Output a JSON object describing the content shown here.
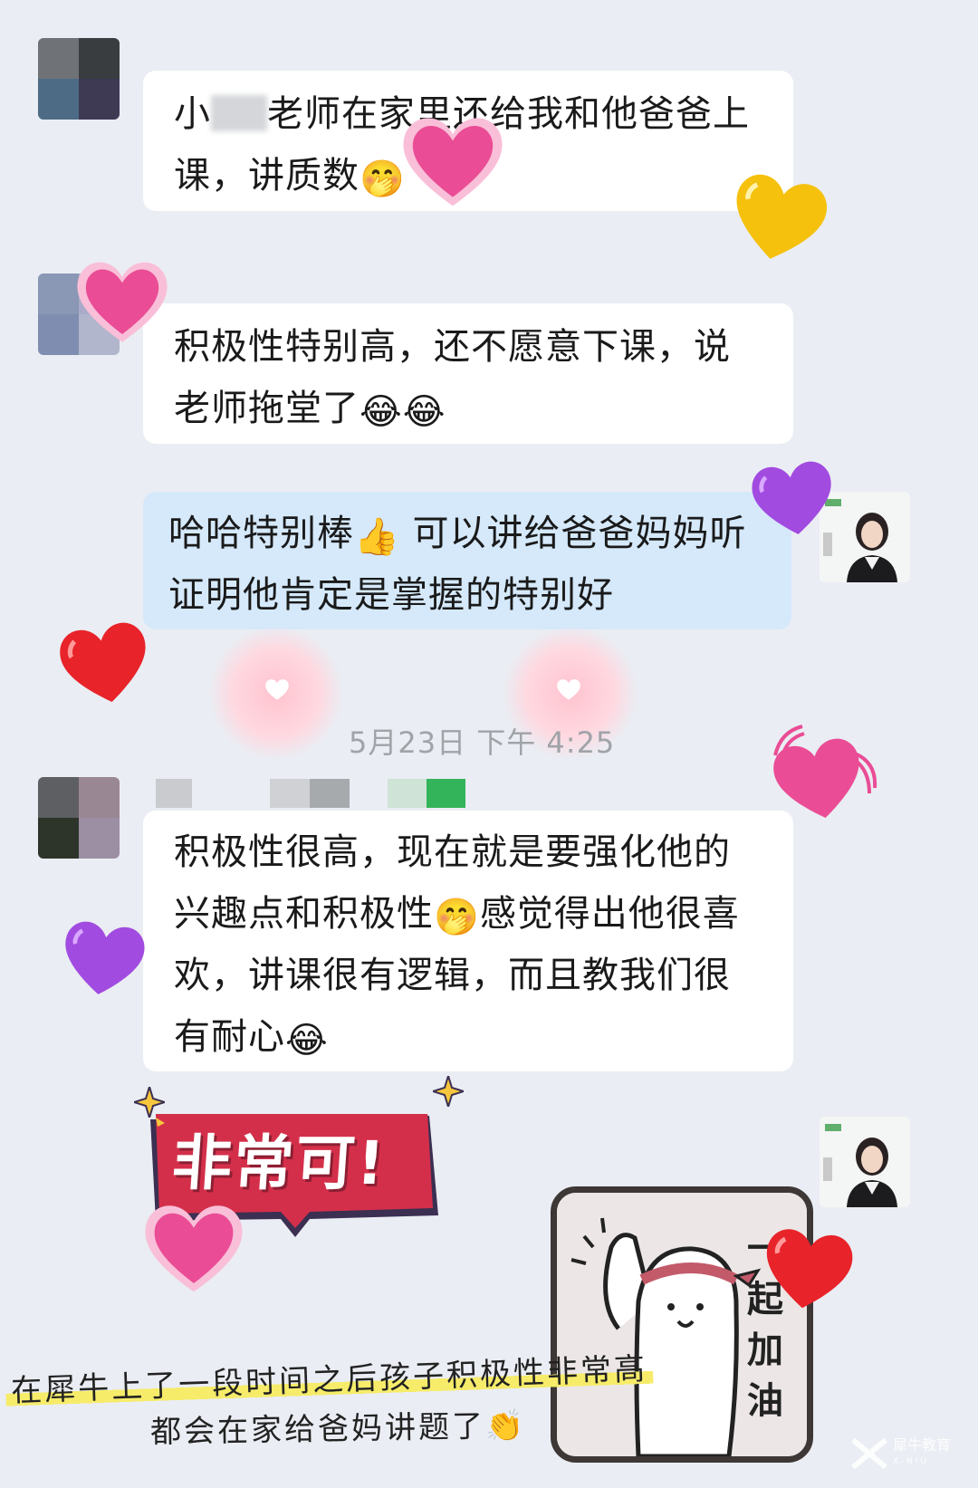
{
  "chat": {
    "messages": [
      {
        "id": "m1",
        "sender": "parent",
        "segments": [
          "小",
          "老师在家里还给我和他爸爸上课，讲质数"
        ],
        "emoji_after": "🤭"
      },
      {
        "id": "m2",
        "sender": "parent",
        "text": "积极性特别高，还不愿意下课，说老师拖堂了",
        "emoji_after": "😂😂"
      },
      {
        "id": "m3",
        "sender": "teacher",
        "text_a": "哈哈特别棒",
        "emoji_mid": "👍",
        "text_b": "可以讲给爸爸妈妈听证明他肯定是掌握的特别好"
      },
      {
        "id": "m4",
        "sender": "parent",
        "text_a": "积极性很高，现在就是要强化他的兴趣点和积极性",
        "emoji_mid": "🤭",
        "text_b": "感觉得出他很喜欢，讲课很有逻辑，而且教我们很有耐心",
        "emoji_after": "😂"
      }
    ],
    "timestamp": "5月23日  下午 4:25"
  },
  "stickers": {
    "main_text": "非常可!",
    "cheer_text": "一起加油"
  },
  "caption": {
    "line1": "在犀牛上了一段时间之后孩子积极性非常高",
    "line2": "都会在家给爸妈讲题了",
    "line2_emoji": "👏"
  },
  "watermark": {
    "brand": "犀牛教育",
    "sub": "X-NIU"
  },
  "colors": {
    "background": "#eaedf3",
    "bubble_other": "#ffffff",
    "bubble_self": "#d5e9fb",
    "sticker_red": "#d42f4a",
    "caption_highlight": "#f6ec6a"
  },
  "icons": [
    "pink-heart-icon",
    "yellow-heart-icon",
    "red-heart-icon",
    "purple-heart-icon",
    "sparkle-icon",
    "clap-icon"
  ]
}
